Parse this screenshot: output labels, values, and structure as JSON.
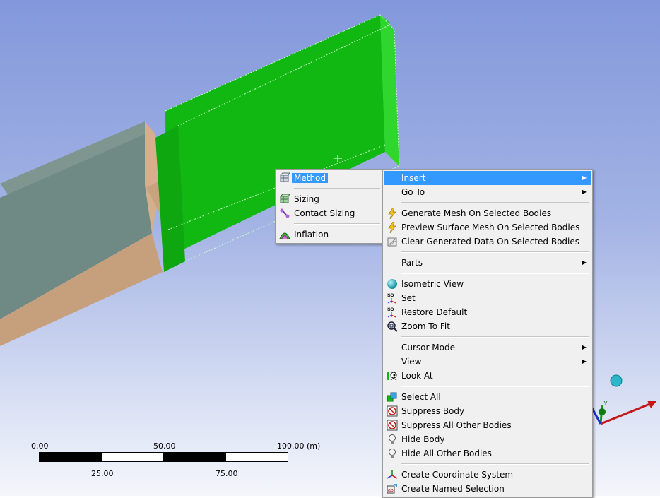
{
  "scale_bar": {
    "top_labels": [
      "0.00",
      "50.00",
      "100.00 (m)"
    ],
    "bottom_labels": [
      "25.00",
      "75.00"
    ]
  },
  "triad": {
    "axis_label": "Y"
  },
  "submenu": {
    "items": [
      {
        "label": "Method",
        "icon": "method-icon"
      },
      {
        "label": "Sizing",
        "icon": "sizing-icon"
      },
      {
        "label": "Contact Sizing",
        "icon": "contact-sizing-icon"
      },
      {
        "label": "Inflation",
        "icon": "inflation-icon"
      }
    ]
  },
  "context_menu": {
    "insert": "Insert",
    "go_to": "Go To",
    "generate_mesh": "Generate Mesh On Selected Bodies",
    "preview_surface_mesh": "Preview Surface Mesh On Selected Bodies",
    "clear_generated": "Clear Generated Data On Selected Bodies",
    "parts": "Parts",
    "isometric_view": "Isometric View",
    "set": "Set",
    "restore_default": "Restore Default",
    "zoom_to_fit": "Zoom To Fit",
    "cursor_mode": "Cursor Mode",
    "view": "View",
    "look_at": "Look At",
    "select_all": "Select All",
    "suppress_body": "Suppress Body",
    "suppress_all_other": "Suppress All Other Bodies",
    "hide_body": "Hide Body",
    "hide_all_other": "Hide All Other Bodies",
    "create_coordinate_system": "Create Coordinate System",
    "create_named_selection": "Create Named Selection"
  },
  "colors": {
    "selected_body": "#12b812",
    "gray_body": "#6f8a84",
    "tan_body": "#c8a280",
    "highlight": "#3399ff",
    "menu_bg": "#f0f0f0"
  }
}
